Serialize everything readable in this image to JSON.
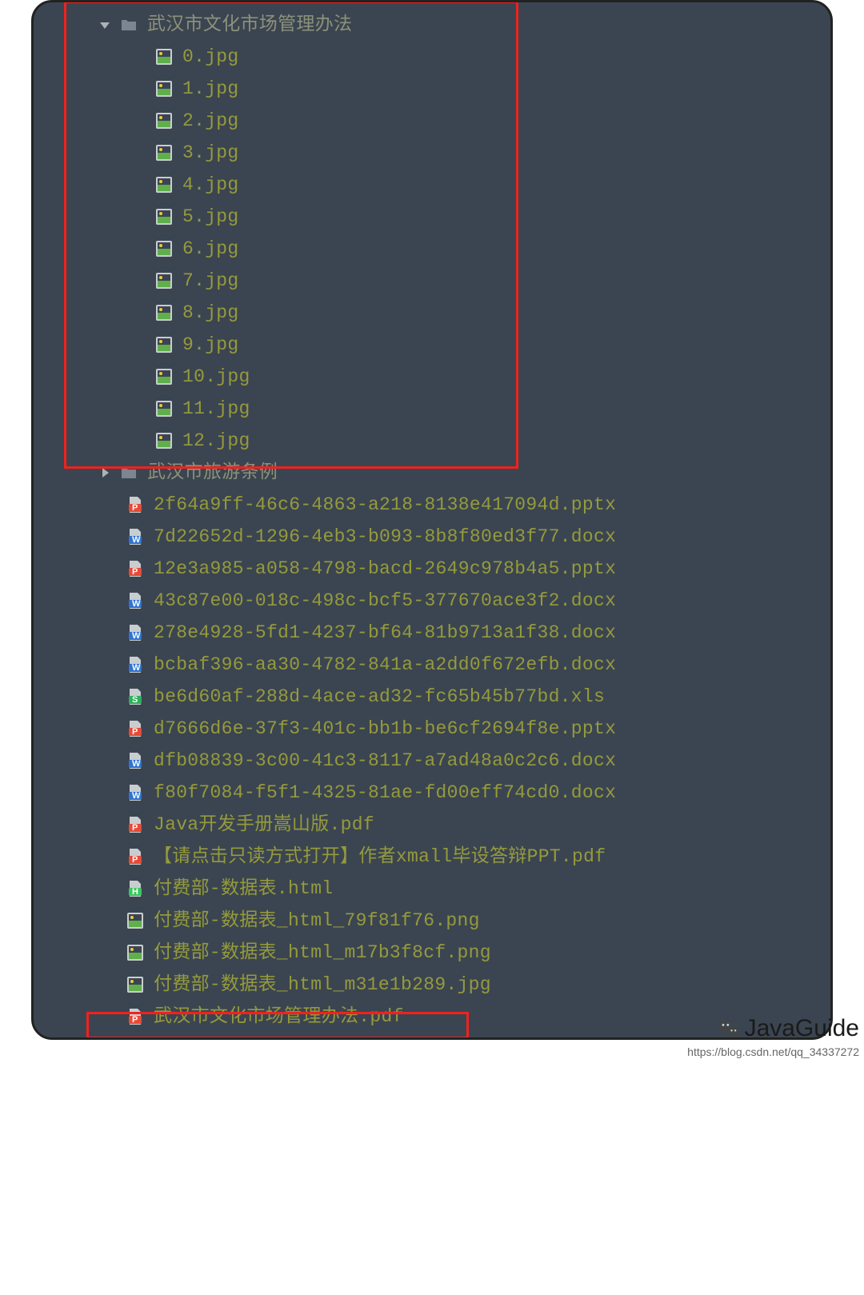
{
  "tree": {
    "folder_expanded": {
      "name": "武汉市文化市场管理办法",
      "expanded": true
    },
    "images": [
      "0.jpg",
      "1.jpg",
      "2.jpg",
      "3.jpg",
      "4.jpg",
      "5.jpg",
      "6.jpg",
      "7.jpg",
      "8.jpg",
      "9.jpg",
      "10.jpg",
      "11.jpg",
      "12.jpg"
    ],
    "folder_collapsed": {
      "name": "武汉市旅游条例",
      "expanded": false
    },
    "files": [
      {
        "name": " 2f64a9ff-46c6-4863-a218-8138e417094d.pptx",
        "type": "pptx"
      },
      {
        "name": " 7d22652d-1296-4eb3-b093-8b8f80ed3f77.docx",
        "type": "docx"
      },
      {
        "name": " 12e3a985-a058-4798-bacd-2649c978b4a5.pptx",
        "type": "pptx"
      },
      {
        "name": "43c87e00-018c-498c-bcf5-377670ace3f2.docx",
        "type": "docx"
      },
      {
        "name": "278e4928-5fd1-4237-bf64-81b9713a1f38.docx",
        "type": "docx"
      },
      {
        "name": "bcbaf396-aa30-4782-841a-a2dd0f672efb.docx",
        "type": "docx"
      },
      {
        "name": "be6d60af-288d-4ace-ad32-fc65b45b77bd.xls",
        "type": "xls"
      },
      {
        "name": " d7666d6e-37f3-401c-bb1b-be6cf2694f8e.pptx",
        "type": "pptx"
      },
      {
        "name": "dfb08839-3c00-41c3-8117-a7ad48a0c2c6.docx",
        "type": "docx"
      },
      {
        "name": " f80f7084-f5f1-4325-81ae-fd00eff74cd0.docx",
        "type": "docx"
      },
      {
        "name": "Java开发手册嵩山版.pdf",
        "type": "pdf"
      },
      {
        "name": "【请点击只读方式打开】作者xmall毕设答辩PPT.pdf",
        "type": "pdf"
      },
      {
        "name": "付费部-数据表.html",
        "type": "html"
      },
      {
        "name": "付费部-数据表_html_79f81f76.png",
        "type": "image"
      },
      {
        "name": "付费部-数据表_html_m17b3f8cf.png",
        "type": "image"
      },
      {
        "name": "付费部-数据表_html_m31e1b289.jpg",
        "type": "image"
      },
      {
        "name": "武汉市文化市场管理办法.pdf",
        "type": "pdf"
      }
    ]
  },
  "watermark": {
    "title": "JavaGuide",
    "url": "https://blog.csdn.net/qq_34337272"
  }
}
